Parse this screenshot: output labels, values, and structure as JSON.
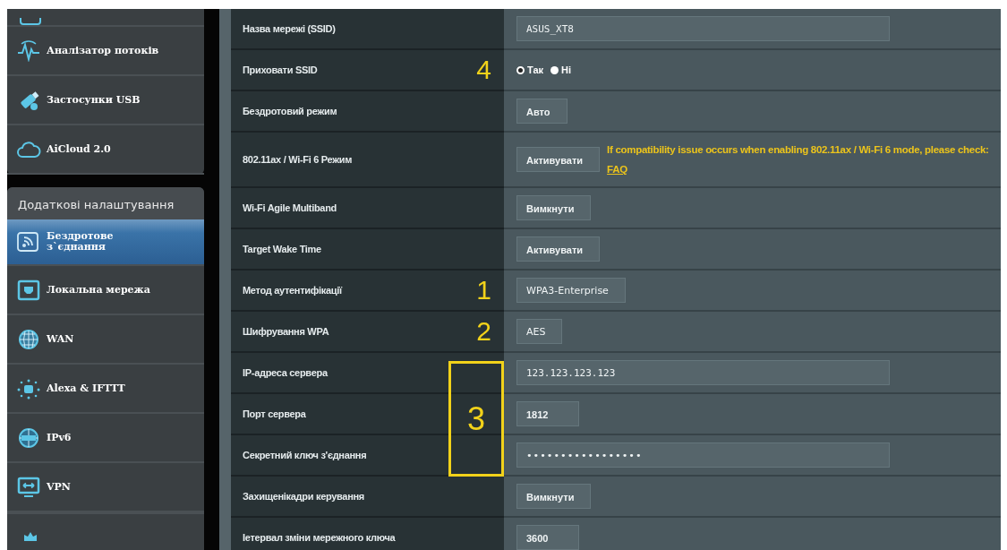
{
  "sidebar": {
    "top_items": [
      {
        "label": "Аналізатор потоків",
        "selected": false
      },
      {
        "label": "Застосунки USB",
        "selected": false
      },
      {
        "label": "AiCloud 2.0",
        "selected": false
      }
    ],
    "section_header": "Додаткові налаштування",
    "items": [
      {
        "label": "Бездротове\nз`єднання",
        "selected": true
      },
      {
        "label": "Локальна мережа",
        "selected": false
      },
      {
        "label": "WAN",
        "selected": false
      },
      {
        "label": "Alexa & IFTTT",
        "selected": false
      },
      {
        "label": "IPv6",
        "selected": false
      },
      {
        "label": "VPN",
        "selected": false
      }
    ]
  },
  "settings": [
    {
      "label": "Назва мережі (SSID)",
      "kind": "text",
      "value": "ASUS_XT8"
    },
    {
      "label": "Приховати SSID",
      "kind": "radio",
      "annotation": "4",
      "options": [
        {
          "label": "Так",
          "selected": true
        },
        {
          "label": "Ні",
          "selected": false
        }
      ]
    },
    {
      "label": "Бездротовий режим",
      "kind": "select",
      "value": "Авто"
    },
    {
      "label": "802.11ax / Wi-Fi 6 Режим",
      "kind": "select",
      "value": "Активувати",
      "note": {
        "text": "If compatibility issue occurs when enabling 802.11ax / Wi-Fi 6 mode, please check:",
        "link": "FAQ"
      }
    },
    {
      "label": "Wi-Fi Agile Multiband",
      "kind": "select",
      "value": "Вимкнути"
    },
    {
      "label": "Target Wake Time",
      "kind": "select",
      "value": "Активувати"
    },
    {
      "label": "Метод аутентифікації",
      "kind": "select",
      "value": "WPA3-Enterprise",
      "annotation": "1"
    },
    {
      "label": "Шифрування WPA",
      "kind": "select",
      "value": "AES",
      "annotation": "2"
    },
    {
      "label": "IP-адреса сервера",
      "kind": "text",
      "value": "123.123.123.123",
      "boxed": true
    },
    {
      "label": "Порт сервера",
      "kind": "number",
      "value": "1812",
      "boxed": true
    },
    {
      "label": "Секретний ключ з'єднання",
      "kind": "password",
      "value": "•••••••••••••••••",
      "boxed": true
    },
    {
      "label": "Захищенікадри керування",
      "kind": "select",
      "value": "Вимкнути"
    },
    {
      "label": "Іетервал зміни мережного ключа",
      "kind": "number",
      "value": "3600"
    }
  ],
  "callout_box": {
    "label": "3"
  }
}
